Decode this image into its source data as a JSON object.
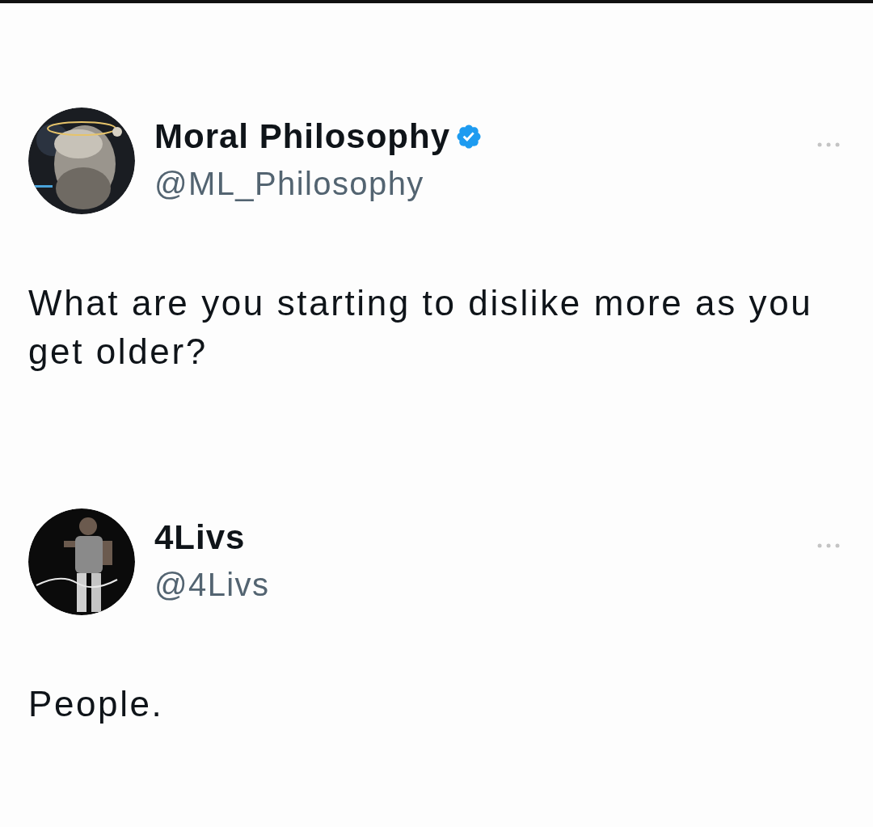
{
  "posts": [
    {
      "name": "Moral Philosophy",
      "verified": true,
      "handle": "@ML_Philosophy",
      "text": "What are you starting to dislike more as you get older?"
    },
    {
      "name": "4Livs",
      "verified": false,
      "handle": "@4Livs",
      "text": "People."
    }
  ]
}
